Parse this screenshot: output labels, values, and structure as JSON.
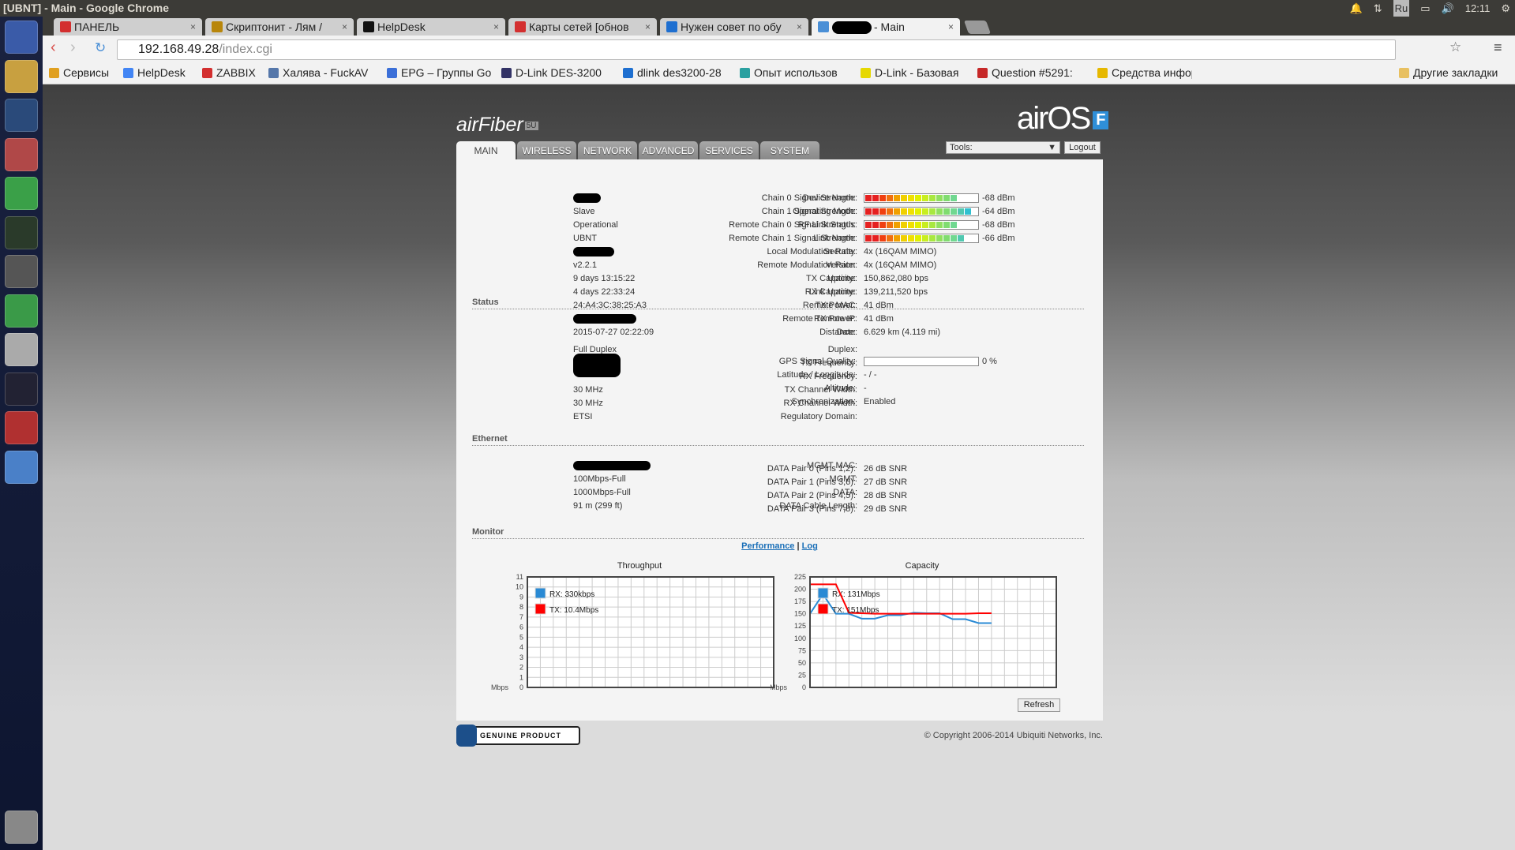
{
  "window": {
    "title": "[UBNT] - Main - Google Chrome",
    "clock": "12:11",
    "lang": "Ru"
  },
  "browser": {
    "tabs": [
      {
        "label": "ПАНЕЛЬ",
        "color": "#d32f2f"
      },
      {
        "label": "Скриптонит - Лям /",
        "color": "#b8860b"
      },
      {
        "label": "HelpDesk",
        "color": "#111111"
      },
      {
        "label": "Карты сетей [обнов",
        "color": "#d32f2f"
      },
      {
        "label": "Нужен совет по обу",
        "color": "#1e6fd0"
      },
      {
        "label": "- Main",
        "color": "#4a8fd6"
      }
    ],
    "url_host": "192.168.49.28",
    "url_path": "/index.cgi",
    "bookmarks": [
      {
        "label": "Сервисы",
        "color": "#e0a020"
      },
      {
        "label": "HelpDesk",
        "color": "#4285f4"
      },
      {
        "label": "ZABBIX",
        "color": "#d32f2f"
      },
      {
        "label": "Халява - FuckAV",
        "color": "#5577aa"
      },
      {
        "label": "EPG – Группы Go",
        "color": "#3b6fd8"
      },
      {
        "label": "D-Link DES-3200",
        "color": "#333366"
      },
      {
        "label": "dlink des3200-28",
        "color": "#1e6fd0"
      },
      {
        "label": "Опыт использов",
        "color": "#2aa0a0"
      },
      {
        "label": "D-Link - Базовая",
        "color": "#e6d800"
      },
      {
        "label": "Question #5291:",
        "color": "#c62828"
      },
      {
        "label": "Средства инфор",
        "color": "#e6b800"
      }
    ],
    "other_bookmarks": "Другие закладки"
  },
  "brand": {
    "product": "airFiber",
    "badge": "5U",
    "os": "airOS",
    "os_badge": "F"
  },
  "nav": {
    "tabs": [
      "MAIN",
      "WIRELESS",
      "NETWORK",
      "ADVANCED",
      "SERVICES",
      "SYSTEM"
    ],
    "tools": "Tools:",
    "logout": "Logout"
  },
  "status": {
    "heading": "Status",
    "left": [
      {
        "label": "Device Name:",
        "value": null,
        "redacted": true
      },
      {
        "label": "Operating Mode:",
        "value": "Slave"
      },
      {
        "label": "RF Link Status:",
        "value": "Operational"
      },
      {
        "label": "Link Name:",
        "value": "UBNT"
      },
      {
        "label": "Security:",
        "value": null,
        "redacted": true
      },
      {
        "label": "Version:",
        "value": "v2.2.1"
      },
      {
        "label": "Uptime:",
        "value": "9 days 13:15:22"
      },
      {
        "label": "Link Uptime:",
        "value": "4 days 22:33:24"
      },
      {
        "label": "Remote MAC:",
        "value": "24:A4:3C:38:25:A3"
      },
      {
        "label": "Remote IP:",
        "value": null,
        "redacted": true
      },
      {
        "label": "Date:",
        "value": "2015-07-27 02:22:09"
      }
    ],
    "left2": [
      {
        "label": "Duplex:",
        "value": "Full Duplex"
      },
      {
        "label": "TX Frequency:",
        "value": null,
        "redacted": true
      },
      {
        "label": "RX Frequency:",
        "value": null,
        "redacted": true
      },
      {
        "label": "TX Channel Width:",
        "value": "30 MHz"
      },
      {
        "label": "RX Channel Width:",
        "value": "30 MHz"
      },
      {
        "label": "Regulatory Domain:",
        "value": "ETSI"
      }
    ],
    "right": [
      {
        "label": "Chain 0 Signal Strength:",
        "value": "-68 dBm",
        "level": 0.8
      },
      {
        "label": "Chain 1 Signal Strength:",
        "value": "-64 dBm",
        "level": 0.92
      },
      {
        "label": "Remote Chain 0 Signal Strength:",
        "value": "-68 dBm",
        "level": 0.8
      },
      {
        "label": "Remote Chain 1 Signal Strength:",
        "value": "-66 dBm",
        "level": 0.86
      },
      {
        "label": "Local Modulation Rate:",
        "value": "4x (16QAM MIMO)"
      },
      {
        "label": "Remote Modulation Rate:",
        "value": "4x (16QAM MIMO)"
      },
      {
        "label": "TX Capacity:",
        "value": "150,862,080 bps"
      },
      {
        "label": "RX Capacity:",
        "value": "139,211,520 bps"
      },
      {
        "label": "TX Power:",
        "value": "41 dBm"
      },
      {
        "label": "Remote TX Power:",
        "value": "41 dBm"
      },
      {
        "label": "Distance:",
        "value": "6.629 km (4.119 mi)"
      }
    ],
    "right2": [
      {
        "label": "GPS Signal Quality:",
        "value": "0 %",
        "level": 0
      },
      {
        "label": "Latitude / Longitude:",
        "value": "- / -"
      },
      {
        "label": "Altitude:",
        "value": "-"
      },
      {
        "label": "Synchronization:",
        "value": "Enabled"
      }
    ]
  },
  "ethernet": {
    "heading": "Ethernet",
    "left": [
      {
        "label": "MGMT MAC:",
        "value": null,
        "redacted": true
      },
      {
        "label": "MGMT:",
        "value": "100Mbps-Full"
      },
      {
        "label": "DATA:",
        "value": "1000Mbps-Full"
      },
      {
        "label": "DATA Cable Length:",
        "value": "91 m (299 ft)"
      }
    ],
    "right": [
      {
        "label": "DATA Pair 0 (Pins 1,2):",
        "value": "26 dB SNR"
      },
      {
        "label": "DATA Pair 1 (Pins 3,6):",
        "value": "27 dB SNR"
      },
      {
        "label": "DATA Pair 2 (Pins 4,5):",
        "value": "28 dB SNR"
      },
      {
        "label": "DATA Pair 3 (Pins 7,8):",
        "value": "29 dB SNR"
      }
    ]
  },
  "monitor": {
    "heading": "Monitor",
    "link_performance": "Performance",
    "separator": "|",
    "link_log": "Log",
    "refresh": "Refresh"
  },
  "chart_data": [
    {
      "type": "line",
      "title": "Throughput",
      "ylabel": "Mbps",
      "ylim": [
        0,
        11
      ],
      "yticks": [
        0,
        1,
        2,
        3,
        4,
        5,
        6,
        7,
        8,
        9,
        10,
        11
      ],
      "xlim": [
        0,
        19
      ],
      "grid": true,
      "legend": "top-left",
      "series": [
        {
          "name": "RX: 330kbps",
          "color": "#2a8ad4",
          "values": []
        },
        {
          "name": "TX: 10.4Mbps",
          "color": "#ff0000",
          "values": []
        }
      ]
    },
    {
      "type": "line",
      "title": "Capacity",
      "ylabel": "Mbps",
      "ylim": [
        0,
        225
      ],
      "yticks": [
        0,
        25,
        50,
        75,
        100,
        125,
        150,
        175,
        200,
        225
      ],
      "xlim": [
        0,
        19
      ],
      "grid": true,
      "legend": "top-left",
      "series": [
        {
          "name": "RX: 131Mbps",
          "color": "#2a8ad4",
          "values": [
            150,
            190,
            150,
            150,
            140,
            140,
            147,
            147,
            152,
            151,
            151,
            139,
            139,
            131,
            131
          ]
        },
        {
          "name": "TX: 151Mbps",
          "color": "#ff0000",
          "values": [
            210,
            210,
            210,
            152,
            151,
            150,
            150,
            150,
            150,
            150,
            150,
            150,
            150,
            151,
            151
          ]
        }
      ]
    }
  ],
  "footer": {
    "genuine": "GENUINE PRODUCT",
    "copyright": "© Copyright 2006-2014 Ubiquiti Networks, Inc."
  }
}
